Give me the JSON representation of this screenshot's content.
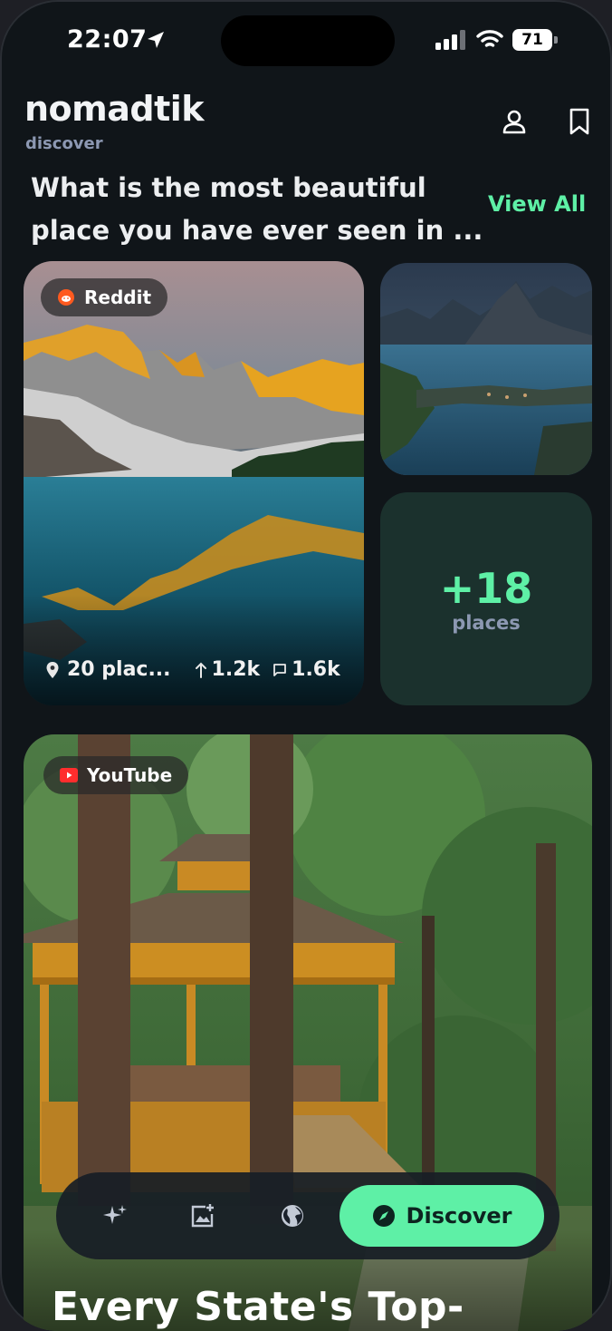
{
  "status_bar": {
    "time": "22:07",
    "battery": "71"
  },
  "header": {
    "title": "nomadtik",
    "subtitle": "discover"
  },
  "section": {
    "title": "What is the most beautiful place you have ever seen in ...",
    "view_all": "View All"
  },
  "featured": {
    "source": "Reddit",
    "places": "20 plac...",
    "upvotes": "1.2k",
    "comments": "1.6k",
    "more_count": "+18",
    "more_label": "places"
  },
  "second_post": {
    "source": "YouTube",
    "title": "Every State's Top-"
  },
  "nav": {
    "discover_label": "Discover"
  },
  "colors": {
    "accent": "#5ef0a6",
    "background": "#101519",
    "muted": "#8c98b2",
    "more_card": "#1b312d"
  }
}
